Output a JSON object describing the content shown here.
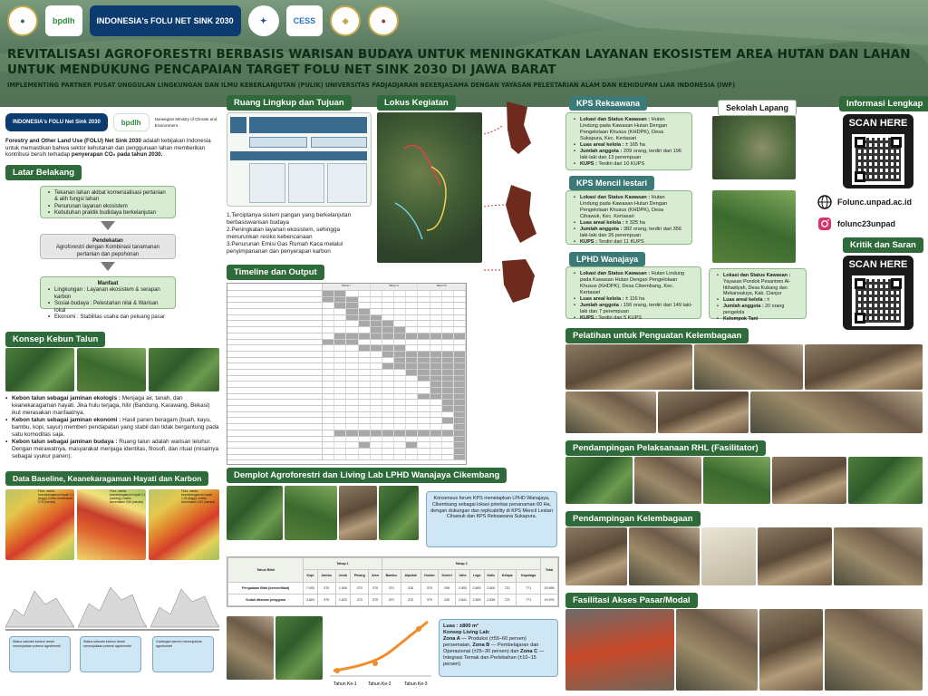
{
  "header": {
    "logos": [
      "bpdlh",
      "INDONESIA's FOLU NET SINK 2030",
      "CESS"
    ],
    "title": "REVITALISASI AGROFORESTRI BERBASIS WARISAN BUDAYA UNTUK MENINGKATKAN LAYANAN EKOSISTEM AREA HUTAN DAN LAHAN UNTUK MENDUKUNG PENCAPAIAN TARGET FOLU NET SINK 2030 DI JAWA BARAT",
    "subtitle": "IMPLEMENTING PARTNER PUSAT UNGGULAN LINGKUNGAN DAN ILMU KEBERLANJUTAN (PULIK) UNIVERSITAS PADJADJARAN BEKERJASAMA DENGAN YAYASAN PELESTARIAN ALAM DAN KEHIDUPAN LIAR INDONESIA (IWF)"
  },
  "intro": {
    "logos": [
      "INDONESIA's FOLU Net Sink 2030",
      "bpdlh",
      "Norwegian Ministry of Climate and Environment"
    ],
    "text_bold": "Forestry and Other Land Use (FOLU) Net Sink 2030",
    "text_rest": " adalah kebijakan Indonesia untuk memastikan bahwa sektor kehutanan dan penggunaan lahan memberikan kontribusi bersih terhadap ",
    "text_bold2": "penyerapan CO₂ pada tahun 2030."
  },
  "latar": {
    "title": "Latar Belakang",
    "items": [
      "Tekanan lahan akibat komersialisasi pertanian & alih fungsi lahan",
      "Penurunan layanan ekosistem",
      "Kebutuhan praktik budidaya berkelanjutan"
    ],
    "pendekatan_title": "Pendekatan",
    "pendekatan_text": "Agroforestri dengan Kombinasi tanamanan pertanian dan pepohonan",
    "manfaat_title": "Manfaat",
    "manfaat": [
      "Lingkungan : Layanan ekosistem & serapan karbon",
      "Sosial-budaya : Pelestarian nilai & Warisan lokal",
      "Ekonomi : Stabilitas usaha dan peluang pasar"
    ]
  },
  "konsep": {
    "title": "Konsep Kebun Talun",
    "items": [
      {
        "bold": "Kebon talun sebagai jaminan ekologis :",
        "text": " Menjaga air, tanah, dan keanekaragaman hayati. Jika hulu terjaga, hilir (Bandung, Karawang, Bekasi) ikut merasakan manfaatnya."
      },
      {
        "bold": "Kebon talun sebagai jaminan ekonomi :",
        "text": " Hasil panen beragam (buah, kayu, bambu, kopi, sayur) memberi pendapatan yang stabil dan tidak bergantung pada satu komoditas saja."
      },
      {
        "bold": "Kebon talun sebagai jaminan budaya :",
        "text": " Ruang talun adalah warisan leluhur. Dengan merawatnya, masyarakat menjaga identitas, filosofi, dan ritual (misalnya sebagai syukur panen)."
      }
    ]
  },
  "baseline": {
    "title": "Data Baseline, Keanekaragaman Hayati dan Karbon",
    "map_captions": [
      "Flora, indeks keanekaragaman hayati 3,1 (tinggi); indeks kemerataan 0,78 (merata)",
      "Flora, indeks keanekaragaman hayati 3,1 (sedang); indeks kemerataan 0,84 (merata)",
      "Flora, indeks keanekaragaman hayati 1,78 (tinggi); indeks kemerataan 0,82 (merata)"
    ],
    "notes": [
      "Status saturasi karbon tanah menunjukkan potensi agroforestri",
      "Status saturasi karbon tanah menunjukkan potensi agroforestri",
      "Cadangan karbon menunjukkan agroforestri"
    ]
  },
  "ruang": {
    "title": "Ruang Lingkup dan Tujuan",
    "tujuan": [
      "Terciptanya sistem pangan yang berkelanjutan berbasiswarisan budaya",
      "Peningkatan layanan ekosistem, sehingga menurunkan resiko kebencanaan",
      "Penurunan Emisi Gas Rumah Kaca melalui penyimpananan dan penyerapan karbon"
    ]
  },
  "lokus": {
    "title": "Lokus Kegiatan"
  },
  "timeline": {
    "title": "Timeline dan Output",
    "years": [
      "Tahun I",
      "Tahun II",
      "Tahun III"
    ]
  },
  "demplot": {
    "title": "Demplot Agroforestri dan Living Lab LPHD Wanajaya Cikembang",
    "text": "Konsensus forum KPS menetapkan LPHD Wanajaya, Cikembang sebagai lokasi prioritas penanaman 60 Ha, dengan dukungan dan replicability di KPS Mencil Lestari Cihawuk dan KPS Reksawana Sukapura.",
    "table_head": [
      "Tahun Bibit",
      "Tahap 1",
      "Tahap 2",
      "Total"
    ],
    "table_cols": [
      "Kopi",
      "Jambu",
      "Jeruk",
      "Pinang",
      "Aren",
      "Bambu",
      "Alpukat",
      "Durian",
      "Kemiri",
      "Jahe",
      "Lega",
      "Kalis",
      "Kelapa",
      "Kapulaga",
      "Total"
    ],
    "rows": [
      {
        "label": "Pengadaan Bibit (bersertifikat)",
        "values": [
          "7.000",
          "370",
          "1.500",
          "370",
          "370",
          "370",
          "315",
          "370",
          "296",
          "2.800",
          "2.800",
          "2.800",
          "722",
          "771",
          "19.956"
        ]
      },
      {
        "label": "Sudah ditanam pengguna",
        "values": [
          "3.803",
          "370",
          "1.622",
          "370",
          "370",
          "370",
          "370",
          "370",
          "240",
          "2.841",
          "2.800",
          "2.835",
          "722",
          "771",
          "19.976"
        ]
      }
    ],
    "stage_labels": [
      "Tahun Ke-1",
      "Tahun Ke-2",
      "Tahun Ke-3"
    ],
    "luas": "Luas : ±800 m²",
    "konsep_title": "Konsep Living Lab:",
    "zona": [
      {
        "bold": "Zona A",
        "text": " — Produksi (±55–60 persen) persemaian, "
      },
      {
        "bold": "Zona B",
        "text": " — Pembelajaran dan Operasional (±25–30 persen) dan "
      },
      {
        "bold": "Zona C",
        "text": " — Integrasi Ternak dan Perlebahan (±10–15 persen)"
      }
    ]
  },
  "kps": [
    {
      "name": "KPS Reksawana",
      "lokasi": "Hutan Lindung pada Kawasan Hutan Dengan Pengelolaan Khusus (KHDPK), Desa Sukapura, Kec. Kertasari",
      "luas": "± 165 ha",
      "anggota": "209 orang, terdiri dari 196 laki-laki dan 13 perempuan",
      "kups": "Terdiri dari 10 KUPS"
    },
    {
      "name": "KPS Mencil lestari",
      "lokasi": "Hutan Lindung pada Kawasan Hutan Dengan Pengelolaan Khusus (KHDPK), Desa Cihawuk, Kec. Kertasari",
      "luas": "± 325 ha",
      "anggota": "382 orang, terdiri dari 356 laki-laki dan 26 perempuan",
      "kups": "Terdiri dari 11 KUPS"
    },
    {
      "name": "LPHD Wanajaya",
      "lokasi": "Hutan Lindung pada Kawasan Hutan Dengan Pengelolaan Khusus (KHDPK), Desa Cikembang, Kec. Kertasari",
      "luas": "± 116 ha",
      "anggota": "156 orang, terdiri dari 149 laki-laki dan 7 perempuan",
      "kups": "Terdiri dari 5 KUPS"
    }
  ],
  "sekolah": {
    "name": "Sekolah Lapang",
    "lokasi": "Yayasan Pondok Pesantren Al-Ittihadiyah, Desa Kubang dan Mekarwaluya, Kab. Cianjur",
    "luas": "± ",
    "anggota": "20 orang pengelola",
    "kelompok": "Kelompok Tani"
  },
  "labels": {
    "lokasi": "Lokasi dan Status Kawasan :",
    "luas": "Luas areal kelola :",
    "anggota": "Jumlah anggota :",
    "kups": "KUPS :"
  },
  "info": {
    "title": "Informasi Lengkap",
    "scan": "SCAN HERE",
    "website": "Folunc.unpad.ac.id",
    "instagram": "folunc23unpad",
    "kritik_title": "Kritik dan Saran",
    "scan2": "SCAN HERE"
  },
  "pelatihan": {
    "title": "Pelatihan untuk Penguatan Kelembagaan"
  },
  "rhl": {
    "title": "Pendampingan Pelaksanaan RHL (Fasilitator)"
  },
  "kelembagaan": {
    "title": "Pendampingan Kelembagaan"
  },
  "pasar": {
    "title": "Fasilitasi Akses Pasar/Modal"
  },
  "colors": {
    "section": "#2f6b3a",
    "accent_green": "#d7ecd0",
    "box_border": "#8fb889"
  }
}
